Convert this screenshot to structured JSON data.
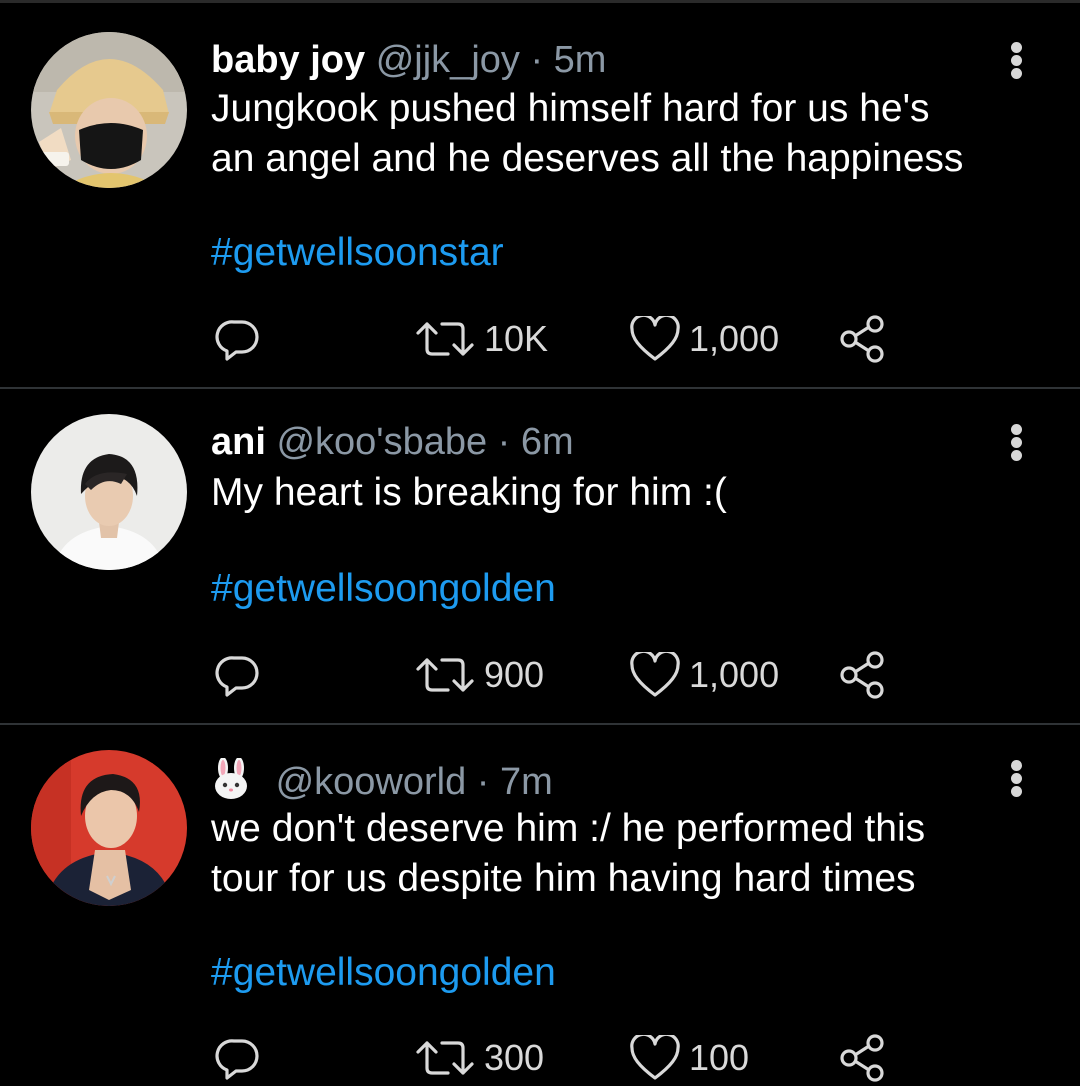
{
  "tweets": [
    {
      "name": "baby joy",
      "handle": "@jjk_joy",
      "separator": "·",
      "time": "5m",
      "text_lines": [
        "Jungkook pushed himself hard for us he's",
        "an angel and he deserves all the happiness"
      ],
      "hashtag": "#getwellsoonstar",
      "retweets": "10K",
      "likes": "1,000",
      "avatar": "masked-person-avatar"
    },
    {
      "name": "ani",
      "handle": "@koo'sbabe",
      "separator": "·",
      "time": "6m",
      "text_lines": [
        "My heart is breaking for him :("
      ],
      "hashtag": "#getwellsoongolden",
      "retweets": "900",
      "likes": "1,000",
      "avatar": "person-avatar"
    },
    {
      "name_emoji": "rabbit-face-icon",
      "handle": "@kooworld",
      "separator": "·",
      "time": "7m",
      "text_lines": [
        "we don't deserve him :/ he performed this",
        "tour for us despite him having hard times"
      ],
      "hashtag": "#getwellsoongolden",
      "retweets": "300",
      "likes": "100",
      "avatar": "person-avatar"
    }
  ],
  "icons": {
    "reply": "reply-icon",
    "retweet": "retweet-icon",
    "like": "heart-icon",
    "share": "share-icon",
    "more": "more-options-icon"
  },
  "colors": {
    "background": "#000000",
    "text": "#ffffff",
    "muted": "#8b98a5",
    "hashtag": "#1d9bf0",
    "divider": "#2f3336",
    "icon": "#d9d9d9"
  }
}
